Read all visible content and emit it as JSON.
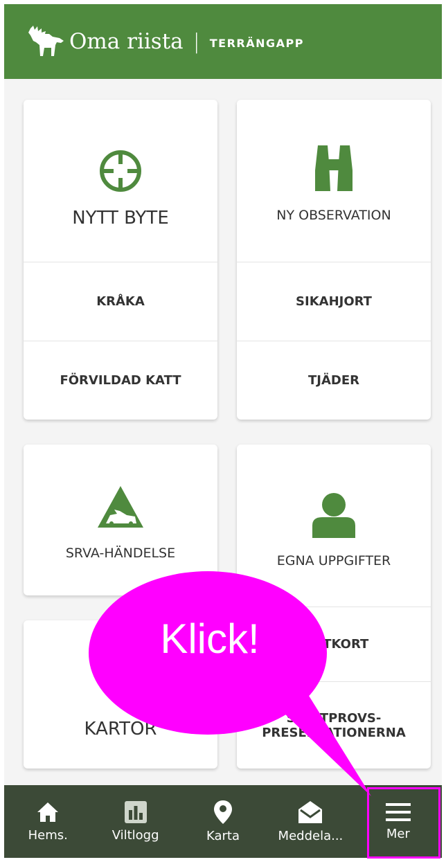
{
  "header": {
    "brand": "Oma riista",
    "separator": "|",
    "subtitle": "TERRÄNGAPP",
    "bg_color": "#4f8a3e"
  },
  "tiles": {
    "nytt_byte": "NYTT BYTE",
    "ny_observation": "NY OBSERVATION",
    "kraka": "KRÅKA",
    "sikahjort": "SIKAHJORT",
    "forvildad_katt": "FÖRVILDAD KATT",
    "tjader": "TJÄDER",
    "srva": "SRVA-HÄNDELSE",
    "egna": "EGNA UPPGIFTER",
    "kartor": "KARTOR",
    "jaktkort": "JAKTKORT",
    "prov_line1": "SKJUTPROVS-",
    "prov_line2": "PRESENTATIONERNA"
  },
  "bottom_nav": {
    "home": "Hems.",
    "viltlogg": "Viltlogg",
    "karta": "Karta",
    "meddela": "Meddela...",
    "mer": "Mer",
    "bg_color": "#3c4a37"
  },
  "annotation": {
    "text": "Klick!",
    "color": "#ff00ff"
  }
}
